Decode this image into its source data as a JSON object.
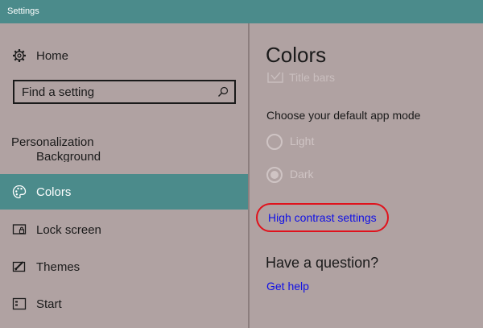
{
  "window": {
    "title": "Settings"
  },
  "sidebar": {
    "home_label": "Home",
    "search": {
      "placeholder": "Find a setting"
    },
    "section_label": "Personalization",
    "items": [
      {
        "label": "Background",
        "icon": "image-icon"
      },
      {
        "label": "Colors",
        "icon": "palette-icon",
        "active": true
      },
      {
        "label": "Lock screen",
        "icon": "lock-screen-icon"
      },
      {
        "label": "Themes",
        "icon": "themes-icon"
      },
      {
        "label": "Start",
        "icon": "start-icon"
      }
    ]
  },
  "main": {
    "title": "Colors",
    "title_bars_label": "Title bars",
    "mode_label": "Choose your default app mode",
    "modes": [
      {
        "label": "Light",
        "selected": false
      },
      {
        "label": "Dark",
        "selected": true
      }
    ],
    "high_contrast_link": "High contrast settings",
    "question_heading": "Have a question?",
    "get_help_link": "Get help"
  },
  "colors": {
    "accent": "#4b8b8b",
    "background": "#b0a2a2",
    "link": "#1010e6",
    "highlight_circle": "#e0121c"
  }
}
